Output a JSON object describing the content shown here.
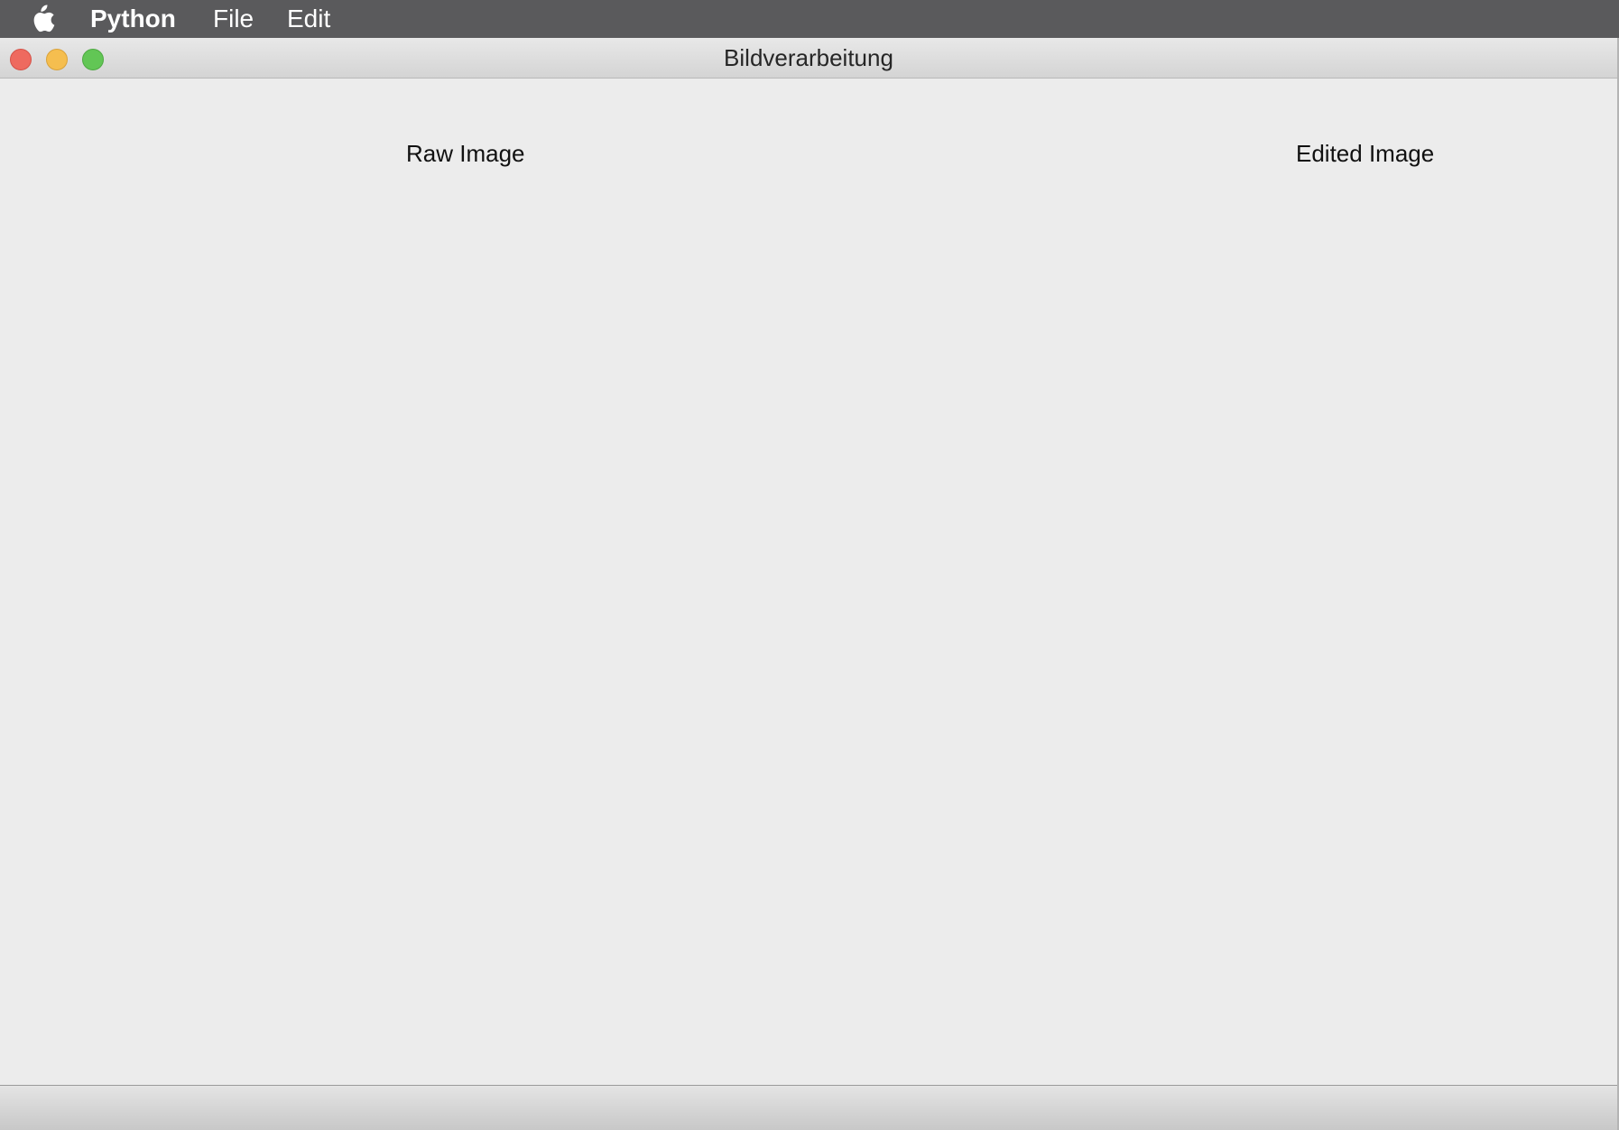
{
  "menubar": {
    "apple_icon": "apple-icon",
    "app_name": "Python",
    "items": [
      {
        "label": "File"
      },
      {
        "label": "Edit"
      }
    ]
  },
  "window": {
    "title": "Bildverarbeitung",
    "controls": {
      "close_color": "#ee6a5f",
      "minimize_color": "#f5be4f",
      "maximize_color": "#62c655"
    }
  },
  "content": {
    "raw_label": "Raw Image",
    "edited_label": "Edited Image"
  }
}
